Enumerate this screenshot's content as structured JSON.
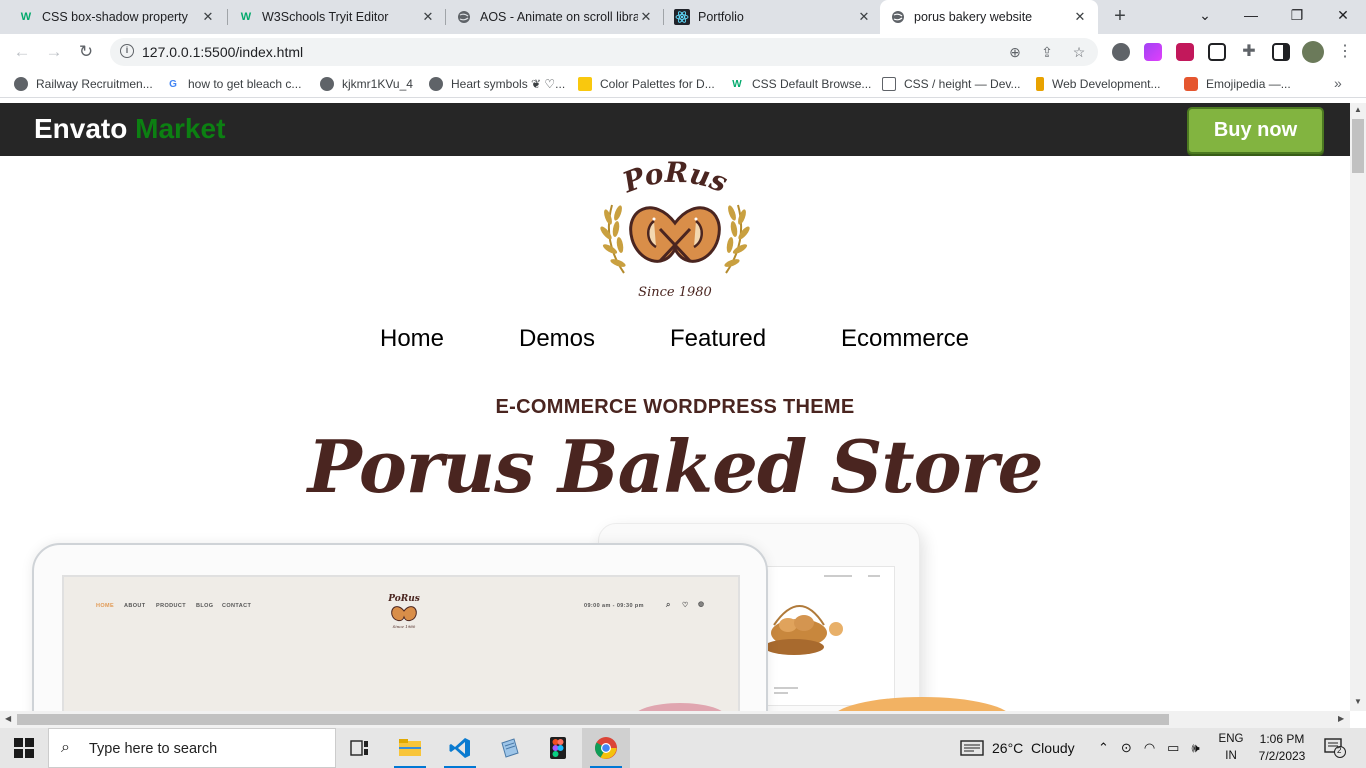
{
  "browser": {
    "tabs": [
      {
        "title": "CSS box-shadow property",
        "icon": "w3schools-icon",
        "active": false
      },
      {
        "title": "W3Schools Tryit Editor",
        "icon": "w3schools-icon",
        "active": false
      },
      {
        "title": "AOS - Animate on scroll libra",
        "icon": "globe-icon",
        "active": false
      },
      {
        "title": "Portfolio",
        "icon": "react-icon",
        "active": false
      },
      {
        "title": "porus bakery website",
        "icon": "globe-icon",
        "active": true
      }
    ],
    "url": "127.0.0.1:5500/index.html",
    "bookmarks": [
      {
        "label": "Railway Recruitmen...",
        "icon": "globe-icon"
      },
      {
        "label": "how to get bleach c...",
        "icon": "google-icon"
      },
      {
        "label": "kjkmr1KVu_4",
        "icon": "globe-icon"
      },
      {
        "label": "Heart symbols ❦ ♡...",
        "icon": "globe-icon"
      },
      {
        "label": "Color Palettes for D...",
        "icon": "palette-icon"
      },
      {
        "label": "CSS Default Browse...",
        "icon": "w3schools-icon"
      },
      {
        "label": "CSS / height — Dev...",
        "icon": "devdocs-icon"
      },
      {
        "label": "Web Development...",
        "icon": "bookmark-icon"
      },
      {
        "label": "Emojipedia —...",
        "icon": "emojipedia-icon"
      }
    ],
    "bookmarks_more": "»"
  },
  "page": {
    "envato": {
      "brand": "Envato",
      "brand_accent": "Market",
      "buy_label": "Buy now"
    },
    "logo": {
      "name": "PoRus",
      "tagline": "Since 1980"
    },
    "menu": [
      "Home",
      "Demos",
      "Featured",
      "Ecommerce"
    ],
    "kicker": "E-COMMERCE WORDPRESS THEME",
    "headline": "Porus Baked Store",
    "preview": {
      "nav": [
        "HOME",
        "ABOUT",
        "PRODUCT",
        "BLOG",
        "CONTACT"
      ],
      "hours": "09:00 am - 09:30 pm",
      "mini_logo": "PoRus",
      "mini_tagline": "Since 1980"
    },
    "colors": {
      "brown": "#4a2520",
      "envato_green": "#0c8012",
      "buy_green": "#82b440"
    }
  },
  "taskbar": {
    "search_placeholder": "Type here to search",
    "apps": [
      "task-view-icon",
      "file-explorer-icon",
      "vscode-icon",
      "notepad-icon",
      "figma-icon",
      "chrome-icon"
    ],
    "weather": "26°C  Cloudy",
    "lang_top": "ENG",
    "lang_bottom": "IN",
    "time": "1:06 PM",
    "date": "7/2/2023",
    "notifications": "2"
  }
}
